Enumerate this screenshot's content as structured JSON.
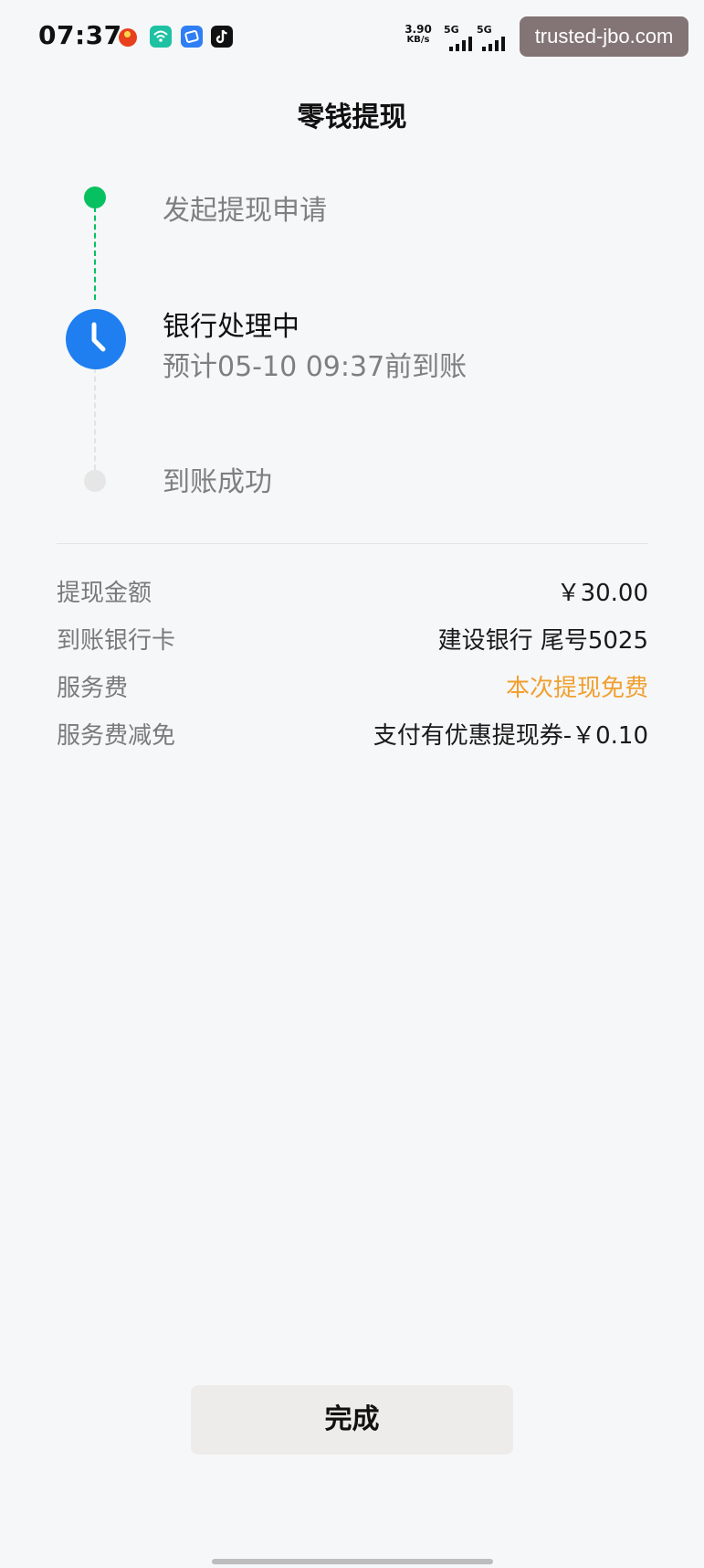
{
  "status_bar": {
    "time": "07:37",
    "net_speed_value": "3.90",
    "net_speed_unit": "KB/s",
    "signal_1_label": "5G",
    "signal_2_label": "5G",
    "app_icons": [
      "weibo-icon",
      "wifi-helper-icon",
      "browser-icon",
      "tiktok-icon"
    ]
  },
  "watermark": "trusted-jbo.com",
  "page": {
    "title": "零钱提现"
  },
  "progress": {
    "steps": [
      {
        "label": "发起提现申请",
        "state": "done"
      },
      {
        "label": "银行处理中",
        "subtitle": "预计05-10 09:37前到账",
        "state": "current"
      },
      {
        "label": "到账成功",
        "state": "pending"
      }
    ],
    "colors": {
      "done": "#07c160",
      "current": "#1f7ff0",
      "pending": "#e6e6e6"
    }
  },
  "details": [
    {
      "label": "提现金额",
      "value": "￥30.00"
    },
    {
      "label": "到账银行卡",
      "value": "建设银行 尾号5025"
    },
    {
      "label": "服务费",
      "value": "本次提现免费",
      "color": "#f0a030"
    },
    {
      "label": "服务费减免",
      "value": "支付有优惠提现券-￥0.10"
    }
  ],
  "actions": {
    "done_label": "完成"
  }
}
